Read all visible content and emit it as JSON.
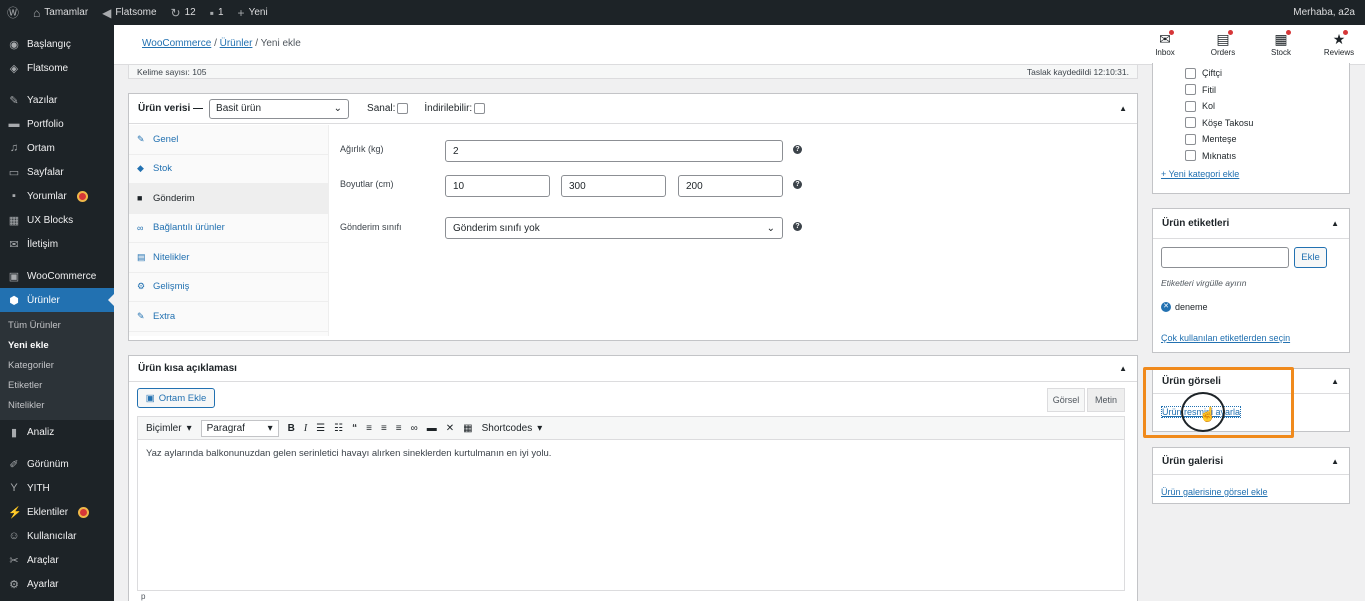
{
  "adminbar": {
    "site_name": "Tamamlar",
    "theme": "Flatsome",
    "updates_count": "12",
    "comments_count": "1",
    "new_label": "Yeni",
    "greeting": "Merhaba, a2a"
  },
  "sidebar": {
    "items": [
      {
        "label": "Başlangıç",
        "icon": "dashboard-icon"
      },
      {
        "label": "Flatsome",
        "icon": "flatsome-icon"
      },
      {
        "label": "Yazılar",
        "icon": "pin-icon"
      },
      {
        "label": "Portfolio",
        "icon": "portfolio-icon"
      },
      {
        "label": "Ortam",
        "icon": "media-icon"
      },
      {
        "label": "Sayfalar",
        "icon": "pages-icon"
      },
      {
        "label": "Yorumlar",
        "icon": "comments-icon"
      },
      {
        "label": "UX Blocks",
        "icon": "blocks-icon"
      },
      {
        "label": "İletişim",
        "icon": "mail-icon"
      },
      {
        "label": "WooCommerce",
        "icon": "woo-icon"
      },
      {
        "label": "Ürünler",
        "icon": "box-icon"
      }
    ],
    "submenu": [
      "Tüm Ürünler",
      "Yeni ekle",
      "Kategoriler",
      "Etiketler",
      "Nitelikler"
    ],
    "items_bottom": [
      {
        "label": "Analiz",
        "icon": "chart-icon"
      },
      {
        "label": "Görünüm",
        "icon": "brush-icon"
      },
      {
        "label": "YITH",
        "icon": "yith-icon"
      },
      {
        "label": "Eklentiler",
        "icon": "plugin-icon"
      },
      {
        "label": "Kullanıcılar",
        "icon": "users-icon"
      },
      {
        "label": "Araçlar",
        "icon": "tools-icon"
      },
      {
        "label": "Ayarlar",
        "icon": "settings-icon"
      }
    ]
  },
  "header": {
    "breadcrumb_1": "WooCommerce",
    "breadcrumb_2": "Ürünler",
    "breadcrumb_current": "Yeni ekle",
    "sep": "/",
    "icons": [
      {
        "label": "Inbox",
        "glyph": "✉"
      },
      {
        "label": "Orders",
        "glyph": "▤"
      },
      {
        "label": "Stock",
        "glyph": "▦"
      },
      {
        "label": "Reviews",
        "glyph": "★"
      }
    ]
  },
  "wordcount": {
    "count_text": "Kelime sayısı: 105",
    "draft_text": "Taslak kaydedildi 12:10:31."
  },
  "product_data": {
    "title": "Ürün verisi —",
    "type_value": "Basit ürün",
    "virtual_label": "Sanal:",
    "downloadable_label": "İndirilebilir:",
    "tabs": [
      {
        "label": "Genel",
        "icon": "wrench-icon"
      },
      {
        "label": "Stok",
        "icon": "diamond-icon"
      },
      {
        "label": "Gönderim",
        "icon": "truck-icon"
      },
      {
        "label": "Bağlantılı ürünler",
        "icon": "link-icon"
      },
      {
        "label": "Nitelikler",
        "icon": "list-icon"
      },
      {
        "label": "Gelişmiş",
        "icon": "gear-icon"
      },
      {
        "label": "Extra",
        "icon": "wrench-icon"
      }
    ],
    "weight_label": "Ağırlık (kg)",
    "weight_value": "2",
    "dimensions_label": "Boyutlar (cm)",
    "length_value": "10",
    "width_value": "300",
    "height_value": "200",
    "shipping_class_label": "Gönderim sınıfı",
    "shipping_class_value": "Gönderim sınıfı yok"
  },
  "short_description": {
    "title": "Ürün kısa açıklaması",
    "add_media": "Ortam Ekle",
    "tab_visual": "Görsel",
    "tab_text": "Metin",
    "format_label": "Biçimler",
    "paragraph_label": "Paragraf",
    "shortcodes_label": "Shortcodes",
    "content": "Yaz aylarında balkonunuzdan gelen serinletici havayı alırken sineklerden kurtulmanın en iyi yolu.",
    "path": "p"
  },
  "categories": {
    "items": [
      "Çiftçi",
      "Fitil",
      "Kol",
      "Köşe Takosu",
      "Menteşe",
      "Mıknatıs"
    ],
    "add_link": "+ Yeni kategori ekle"
  },
  "tags": {
    "title": "Ürün etiketleri",
    "add_button": "Ekle",
    "hint": "Etiketleri virgülle ayırın",
    "tag": "deneme",
    "popular_link": "Çok kullanılan etiketlerden seçin"
  },
  "product_image": {
    "title": "Ürün görseli",
    "set_link": "Ürün resmini ayarla"
  },
  "gallery": {
    "title": "Ürün galerisi",
    "add_link": "Ürün galerisine görsel ekle"
  },
  "colors": {
    "accent": "#2271b1",
    "highlight": "#f08a1c",
    "sidebar": "#1d2327"
  }
}
